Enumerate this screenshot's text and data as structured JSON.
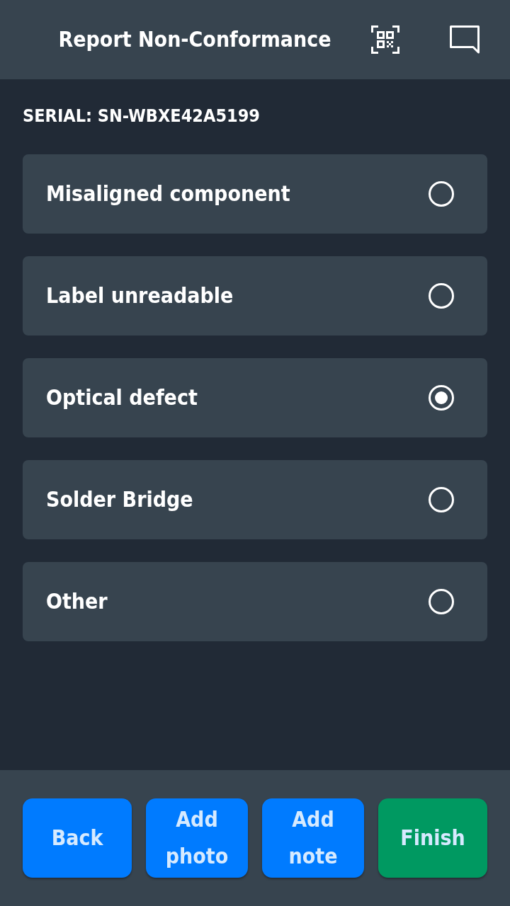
{
  "header": {
    "title": "Report Non-Conformance"
  },
  "serial": "SERIAL: SN-WBXE42A5199",
  "options": [
    {
      "label": "Misaligned component",
      "selected": false
    },
    {
      "label": "Label unreadable",
      "selected": false
    },
    {
      "label": "Optical defect",
      "selected": true
    },
    {
      "label": "Solder Bridge",
      "selected": false
    },
    {
      "label": "Other",
      "selected": false
    }
  ],
  "buttons": [
    {
      "label": "Back",
      "kind": "primary"
    },
    {
      "label": "Add photo",
      "kind": "primary"
    },
    {
      "label": "Add note",
      "kind": "primary"
    },
    {
      "label": "Finish",
      "kind": "success"
    }
  ]
}
